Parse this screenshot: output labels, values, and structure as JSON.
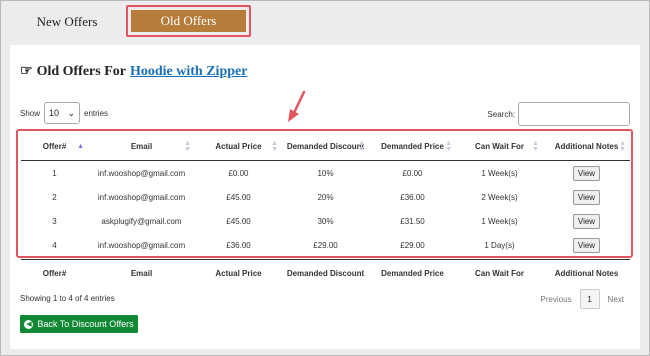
{
  "tabs": [
    {
      "label": "New Offers",
      "active": false
    },
    {
      "label": "Old Offers",
      "active": true
    }
  ],
  "heading": {
    "prefix": "Old Offers For",
    "product_link": "Hoodie with Zipper",
    "icon": "hand-pointing-right-icon"
  },
  "length_menu": {
    "show": "Show",
    "value": "10",
    "entries": "entries"
  },
  "search": {
    "label": "Search:",
    "value": ""
  },
  "columns": [
    "Offer#",
    "Email",
    "Actual Price",
    "Demanded Discount",
    "Demanded Price",
    "Can Wait For",
    "Additional Notes"
  ],
  "rows": [
    {
      "offer": "1",
      "email": "inf.wooshop@gmail.com",
      "actual_price": "£0.00",
      "discount": "10%",
      "demanded_price": "£0.00",
      "wait": "1 Week(s)",
      "notes": "View"
    },
    {
      "offer": "2",
      "email": "inf.wooshop@gmail.com",
      "actual_price": "£45.00",
      "discount": "20%",
      "demanded_price": "£36.00",
      "wait": "2 Week(s)",
      "notes": "View"
    },
    {
      "offer": "3",
      "email": "askplugify@gmail.com",
      "actual_price": "£45.00",
      "discount": "30%",
      "demanded_price": "£31.50",
      "wait": "1 Week(s)",
      "notes": "View"
    },
    {
      "offer": "4",
      "email": "inf.wooshop@gmail.com",
      "actual_price": "£36.00",
      "discount": "£29.00",
      "demanded_price": "£29.00",
      "wait": "1 Day(s)",
      "notes": "View"
    }
  ],
  "info": "Showing 1 to 4 of 4 entries",
  "pagination": {
    "previous": "Previous",
    "current": "1",
    "next": "Next"
  },
  "back_button": "Back To Discount Offers",
  "colors": {
    "accent_tab": "#b57c3a",
    "highlight": "#e2555f",
    "back_button": "#118834",
    "link": "#1a6fb5"
  }
}
